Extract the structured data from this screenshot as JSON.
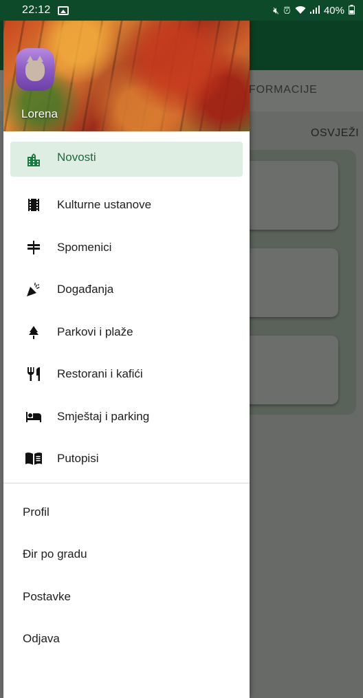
{
  "status_bar": {
    "time": "22:12",
    "battery": "40%",
    "icons": [
      "gallery-icon",
      "mute-icon",
      "alarm-icon",
      "wifi-icon",
      "signal-icon",
      "battery-icon"
    ]
  },
  "background": {
    "tab_label": "FORMACIJE",
    "refresh_button": "OSVJEŽI"
  },
  "drawer": {
    "user_name": "Lorena",
    "menu": [
      {
        "label": "Novosti",
        "icon": "city-icon",
        "selected": true
      },
      {
        "label": "Kulturne ustanove",
        "icon": "film-icon"
      },
      {
        "label": "Spomenici",
        "icon": "signpost-icon"
      },
      {
        "label": "Događanja",
        "icon": "party-popper-icon"
      },
      {
        "label": "Parkovi i plaže",
        "icon": "tree-icon"
      },
      {
        "label": "Restorani i kafići",
        "icon": "restaurant-icon"
      },
      {
        "label": "Smještaj i parking",
        "icon": "hotel-bed-icon"
      },
      {
        "label": "Putopisi",
        "icon": "book-icon"
      }
    ],
    "secondary": [
      "Profil",
      "Đir po gradu",
      "Postavke",
      "Odjava"
    ]
  },
  "colors": {
    "status_bar": "#0d4a2a",
    "accent": "#1a6b3a",
    "selected_bg": "#dfeee3"
  }
}
